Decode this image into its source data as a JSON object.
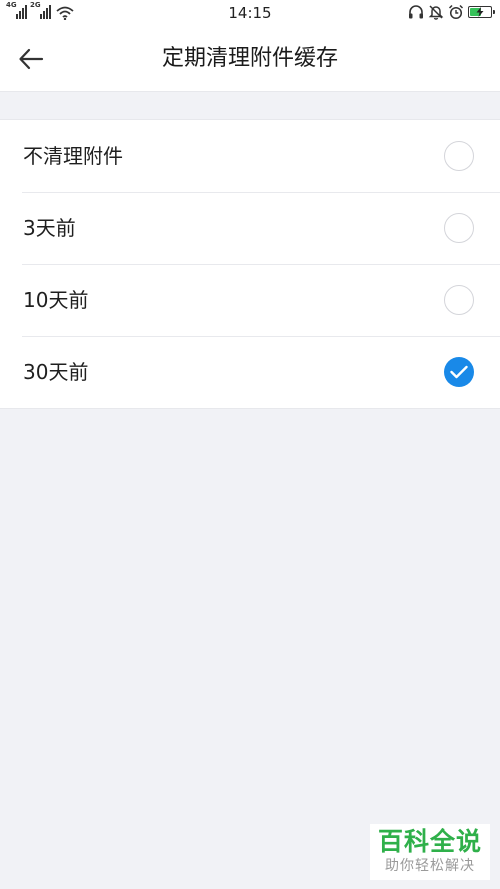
{
  "status_bar": {
    "sim1_network": "4G",
    "sim2_network": "2G",
    "time": "14:15",
    "icons": [
      "headset-icon",
      "bell-muted-icon",
      "alarm-icon",
      "battery-charging-icon"
    ],
    "battery_level": 0.6
  },
  "header": {
    "back_icon": "arrow-left-icon",
    "title": "定期清理附件缓存"
  },
  "options": [
    {
      "label": "不清理附件",
      "checked": false
    },
    {
      "label": "3天前",
      "checked": false
    },
    {
      "label": "10天前",
      "checked": false
    },
    {
      "label": "30天前",
      "checked": true
    }
  ],
  "watermark": {
    "title": "百科全说",
    "subtitle": "助你轻松解决"
  },
  "colors": {
    "accent": "#1989e8",
    "background": "#f1f2f6",
    "watermark_green": "#2fb04a",
    "battery_green": "#36c25a"
  }
}
